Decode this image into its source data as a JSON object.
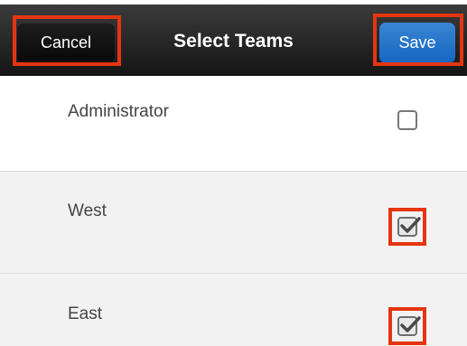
{
  "navbar": {
    "title": "Select Teams",
    "cancel_label": "Cancel",
    "save_label": "Save"
  },
  "teams": [
    {
      "label": "Administrator",
      "checked": false
    },
    {
      "label": "West",
      "checked": true
    },
    {
      "label": "East",
      "checked": true
    }
  ],
  "colors": {
    "navbar": "#1f1f1f",
    "save_button": "#2174c9",
    "highlight": "#e53510",
    "row_alt_background": "#f2f2f2"
  },
  "icons": {
    "checkbox_checked": "checkbox-checked-icon",
    "checkbox_empty": "checkbox-empty-icon"
  }
}
